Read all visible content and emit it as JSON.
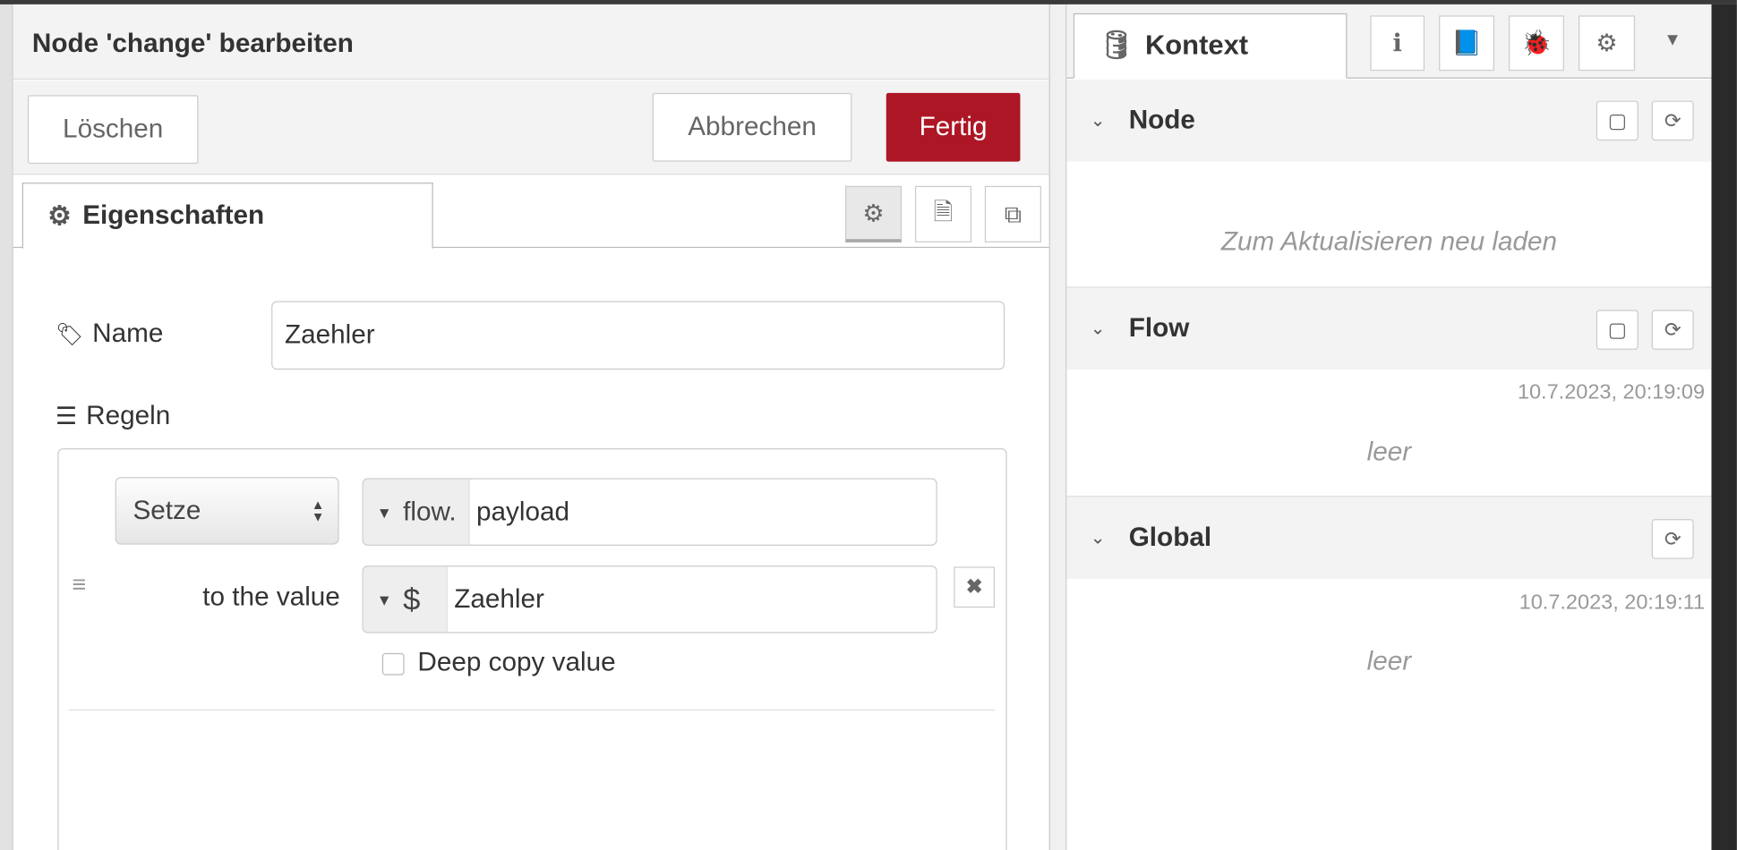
{
  "editor": {
    "title": "Node 'change' bearbeiten",
    "delete_label": "Löschen",
    "cancel_label": "Abbrechen",
    "done_label": "Fertig",
    "tab_properties": "Eigenschaften",
    "name_label": "Name",
    "name_value": "Zaehler",
    "rules_label": "Regeln",
    "rule": {
      "action": "Setze",
      "target_type": "flow.",
      "target_value": "payload",
      "to_label": "to the value",
      "value_type": "$",
      "value": "Zaehler",
      "deep_copy_label": "Deep copy value",
      "deep_copy_checked": false
    }
  },
  "sidebar": {
    "tab_label": "Kontext",
    "sections": [
      {
        "title": "Node",
        "message": "Zum Aktualisieren neu laden"
      },
      {
        "title": "Flow",
        "timestamp": "10.7.2023, 20:19:09",
        "message": "leer"
      },
      {
        "title": "Global",
        "timestamp": "10.7.2023, 20:19:11",
        "message": "leer"
      }
    ]
  },
  "colors": {
    "primary": "#ad1625"
  }
}
